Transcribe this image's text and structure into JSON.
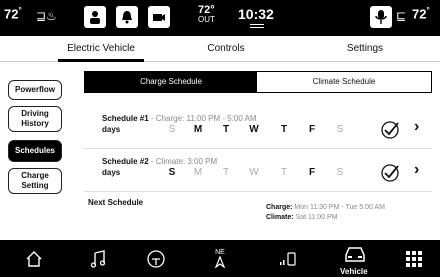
{
  "status": {
    "left_temp": "72",
    "out_temp": "72",
    "out_label": "OUT",
    "time": "10:32",
    "right_temp": "72"
  },
  "tabs": [
    "Electric Vehicle",
    "Controls",
    "Settings"
  ],
  "side_nav": [
    "Powerflow",
    "Driving History",
    "Schedules",
    "Charge Setting"
  ],
  "subtabs": [
    "Charge Schedule",
    "Climate Schedule"
  ],
  "schedules": [
    {
      "title": "Schedule #1",
      "detail": " - Charge: 11:00 PM - 5:00 AM",
      "days_label": "days",
      "days": [
        "S",
        "M",
        "T",
        "W",
        "T",
        "F",
        "S"
      ],
      "active": [
        false,
        true,
        true,
        true,
        true,
        true,
        false
      ]
    },
    {
      "title": "Schedule #2",
      "detail": " - Climate: 3:00 PM",
      "days_label": "days",
      "days": [
        "S",
        "M",
        "T",
        "W",
        "T",
        "F",
        "S"
      ],
      "active": [
        true,
        false,
        false,
        false,
        false,
        true,
        false
      ]
    }
  ],
  "next": {
    "label": "Next Schedule",
    "charge_label": "Charge:",
    "charge_value": "Mon 11:30 PM - Tue 5:00 AM",
    "climate_label": "Climate:",
    "climate_value": "Sat 11:00 PM"
  },
  "dock": {
    "compass": "NE",
    "vehicle_label": "Vehicle"
  },
  "colors": {
    "accent": "#000000",
    "muted": "#888888"
  }
}
